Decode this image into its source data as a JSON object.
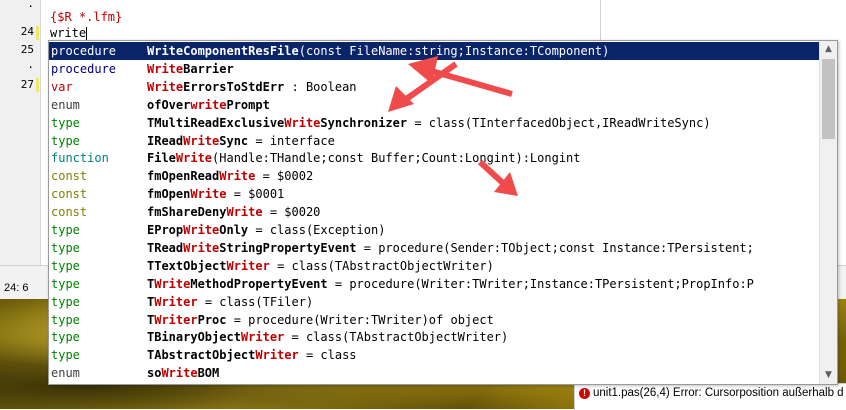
{
  "editor": {
    "gutter": [
      "·",
      "24",
      "25",
      "·",
      "27"
    ],
    "directive": "{$R *.lfm}",
    "typed": "write"
  },
  "completion": {
    "items": [
      {
        "kind": "procedure",
        "pre": "",
        "hl": "Write",
        "post": "ComponentResFile",
        "rest": "(const FileName:string;Instance:TComponent)"
      },
      {
        "kind": "procedure",
        "pre": "",
        "hl": "Write",
        "post": "Barrier",
        "rest": ""
      },
      {
        "kind": "var",
        "pre": "",
        "hl": "Write",
        "post": "ErrorsToStdErr",
        "rest": " : Boolean"
      },
      {
        "kind": "enum",
        "pre": "ofOver",
        "hl": "write",
        "post": "Prompt",
        "rest": ""
      },
      {
        "kind": "type",
        "pre": "TMultiReadExclusive",
        "hl": "Write",
        "post": "Synchronizer",
        "rest": " = class(TInterfacedObject,IReadWriteSync)"
      },
      {
        "kind": "type",
        "pre": "IRead",
        "hl": "Write",
        "post": "Sync",
        "rest": " = interface"
      },
      {
        "kind": "function",
        "pre": "File",
        "hl": "Write",
        "post": "",
        "rest": "(Handle:THandle;const Buffer;Count:Longint):Longint"
      },
      {
        "kind": "const",
        "pre": "fmOpenRead",
        "hl": "Write",
        "post": "",
        "rest": " = $0002"
      },
      {
        "kind": "const",
        "pre": "fmOpen",
        "hl": "Write",
        "post": "",
        "rest": " = $0001"
      },
      {
        "kind": "const",
        "pre": "fmShareDeny",
        "hl": "Write",
        "post": "",
        "rest": " = $0020"
      },
      {
        "kind": "type",
        "pre": "EProp",
        "hl": "Write",
        "post": "Only",
        "rest": " = class(Exception)"
      },
      {
        "kind": "type",
        "pre": "TRead",
        "hl": "Write",
        "post": "StringPropertyEvent",
        "rest": " = procedure(Sender:TObject;const Instance:TPersistent;"
      },
      {
        "kind": "type",
        "pre": "TTextObject",
        "hl": "Writer",
        "post": "",
        "rest": " = class(TAbstractObjectWriter)"
      },
      {
        "kind": "type",
        "pre": "T",
        "hl": "Write",
        "post": "MethodPropertyEvent",
        "rest": " = procedure(Writer:TWriter;Instance:TPersistent;PropInfo:P"
      },
      {
        "kind": "type",
        "pre": "T",
        "hl": "Writer",
        "post": "",
        "rest": " = class(TFiler)"
      },
      {
        "kind": "type",
        "pre": "T",
        "hl": "Writer",
        "post": "Proc",
        "rest": " = procedure(Writer:TWriter)of object"
      },
      {
        "kind": "type",
        "pre": "TBinaryObject",
        "hl": "Writer",
        "post": "",
        "rest": " = class(TAbstractObjectWriter)"
      },
      {
        "kind": "type",
        "pre": "TAbstractObject",
        "hl": "Writer",
        "post": "",
        "rest": " = class"
      },
      {
        "kind": "enum",
        "pre": "so",
        "hl": "Write",
        "post": "BOM",
        "rest": ""
      }
    ]
  },
  "status": {
    "position": "24:  6"
  },
  "messages": {
    "error_icon": "error-icon",
    "text": "unit1.pas(26,4) Error: Cursorposition außerhalb d"
  },
  "scrollbar": {
    "up": "▲",
    "down": "▼"
  },
  "annotation": {
    "arrow_color": "#f04a4a"
  }
}
